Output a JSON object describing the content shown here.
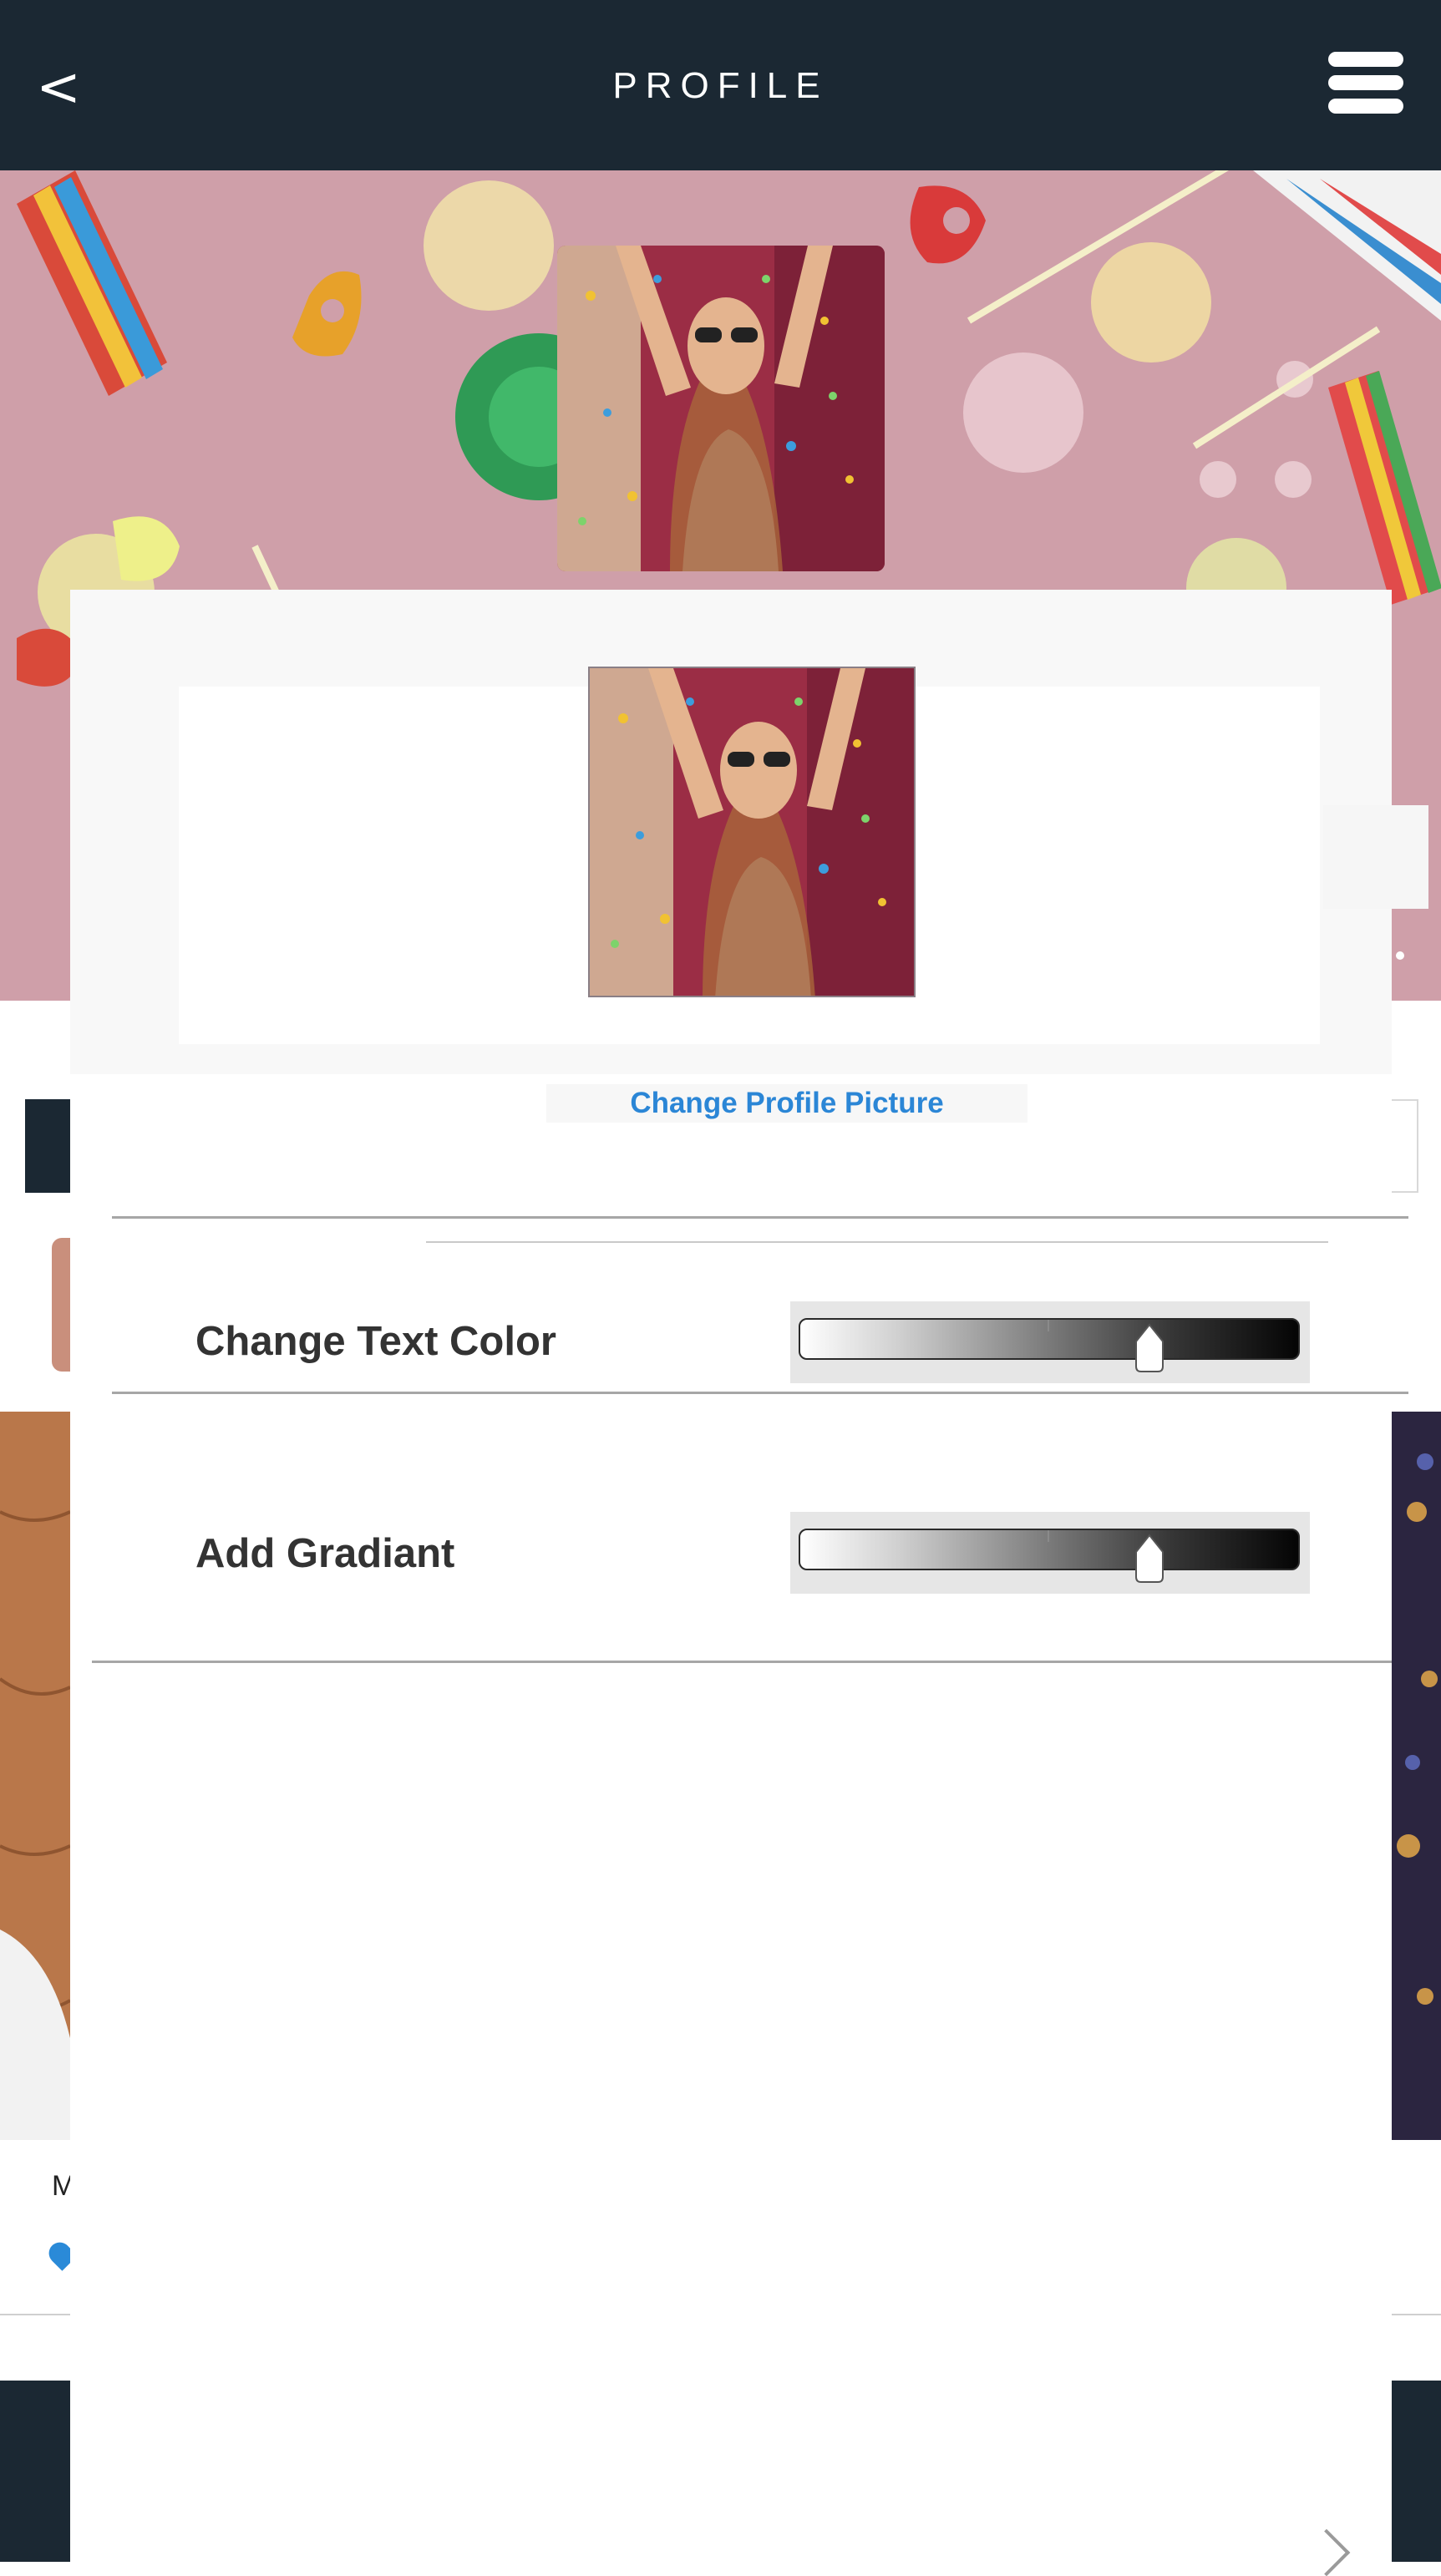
{
  "header": {
    "back_label": "<",
    "title": "PROFILE",
    "menu_icon": "hamburger-menu-icon"
  },
  "cover": {
    "background": "candy-pattern-image",
    "profile_photo": "confetti-portrait-photo"
  },
  "editor": {
    "preview_photo": "confetti-portrait-photo",
    "change_picture_label": "Change Profile Picture",
    "settings": [
      {
        "label": "Change Text Color",
        "slider_value": 0.7
      },
      {
        "label": "Add Gradiant",
        "slider_value": 0.7
      }
    ]
  },
  "background_page": {
    "truncated_text": "M"
  },
  "colors": {
    "header_bg": "#1b2833",
    "link": "#2b86d6",
    "label_text": "#333333"
  }
}
